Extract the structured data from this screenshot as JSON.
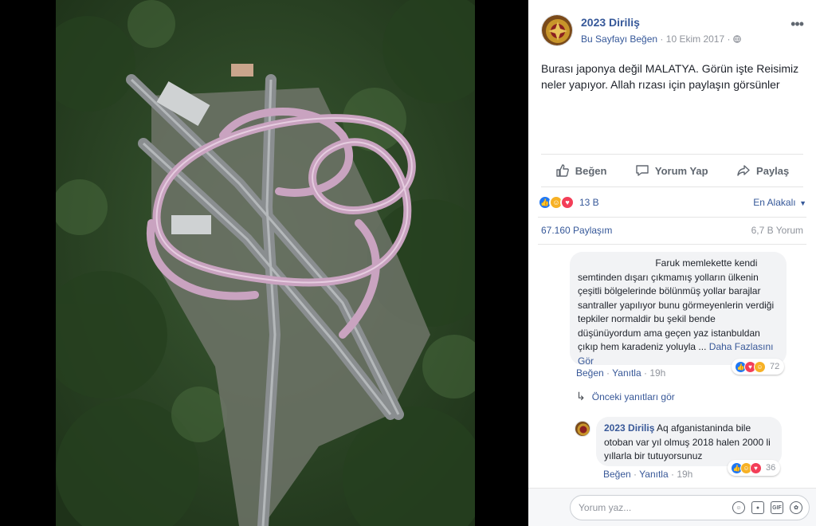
{
  "post": {
    "page_name": "2023 Diriliş",
    "like_page_label": "Bu Sayfayı Beğen",
    "separator": "·",
    "date": "10 Ekim 2017",
    "privacy_icon": "globe-icon",
    "text": "Burası japonya değil MALATYA. Görün işte Reisimiz neler yapıyor. Allah rızası için paylaşın görsünler",
    "more_icon": "ellipsis-icon"
  },
  "actions": {
    "like": "Beğen",
    "comment": "Yorum Yap",
    "share": "Paylaş"
  },
  "reactions": {
    "count": "13 B",
    "sort_label": "En Alakalı",
    "types": [
      "like",
      "haha",
      "love"
    ]
  },
  "stats": {
    "shares": "67.160 Paylaşım",
    "comments": "6,7 B Yorum"
  },
  "comments": [
    {
      "text": "Faruk memlekette kendi semtinden dışarı çıkmamış yolların ülkenin çeşitli bölgelerinde bölünmüş yollar barajlar santraller yapılıyor bunu görmeyenlerin verdiği tepkiler normaldir bu şekil bende düşünüyordum ama geçen yaz istanbuldan çıkıp hem karadeniz yoluyla",
      "more_prefix": "...",
      "more": "Daha Fazlasını Gör",
      "like": "Beğen",
      "reply": "Yanıtla",
      "time": "19h",
      "reaction_count": "72"
    }
  ],
  "previous_replies": "Önceki yanıtları gör",
  "reply": {
    "author": "2023 Diriliş",
    "text": "Aq afganistaninda bile otoban var yıl olmuş 2018 halen 2000 li yıllarla bir tutuyorsunuz",
    "like": "Beğen",
    "reply": "Yanıtla",
    "time": "19h",
    "reaction_count": "36"
  },
  "compose": {
    "placeholder": "Yorum yaz...",
    "icons": [
      "emoji-icon",
      "camera-icon",
      "gif-icon",
      "sticker-icon"
    ]
  },
  "colors": {
    "link": "#365899",
    "like_blue": "#2078f4",
    "haha_yellow": "#f7b125",
    "love_red": "#f33e58",
    "forest": "#2f4a2a"
  }
}
